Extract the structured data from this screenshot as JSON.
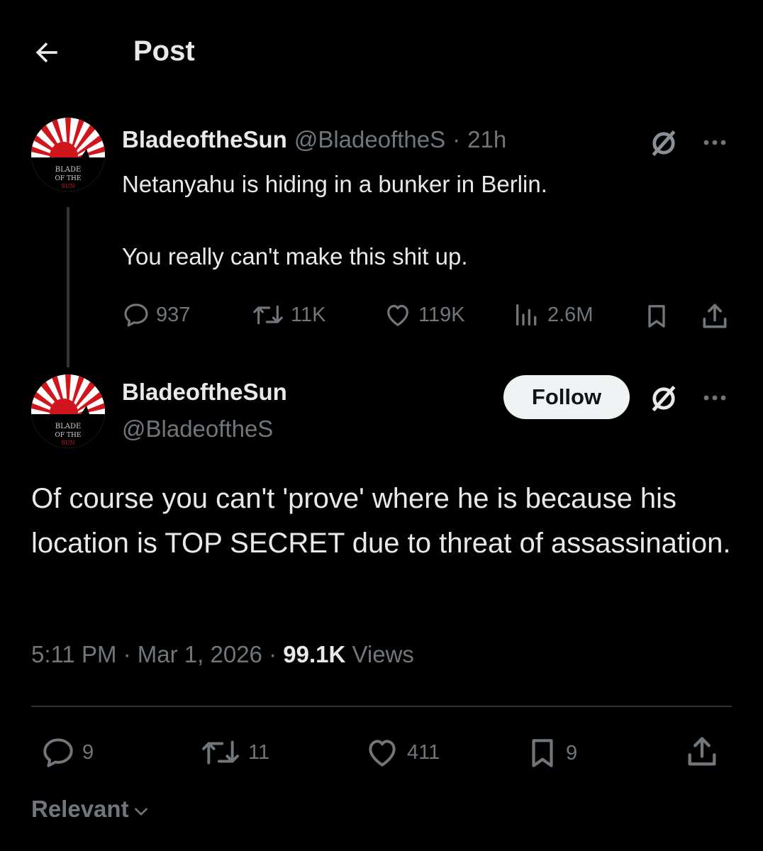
{
  "header": {
    "title": "Post",
    "back_icon": "arrow-left-icon"
  },
  "parent_post": {
    "avatar_text": [
      "BLADE",
      "OF THE",
      "SUN"
    ],
    "name": "BladeoftheSun",
    "handle": "@BladeoftheS",
    "separator": "·",
    "time": "21h",
    "line1": "Netanyahu is hiding in a bunker in Berlin.",
    "line2": "You really can't make this shit up.",
    "stats": {
      "replies": "937",
      "reposts": "11K",
      "likes": "119K",
      "views": "2.6M"
    }
  },
  "main_post": {
    "avatar_text": [
      "BLADE",
      "OF THE",
      "SUN"
    ],
    "name": "BladeoftheSun",
    "handle": "@BladeoftheS",
    "follow_label": "Follow",
    "text": "Of course you can't 'prove' where he is because his location is TOP SECRET due to threat of assassination.",
    "time": "5:11 PM",
    "date": "Mar 1, 2026",
    "separator": "·",
    "views_count": "99.1K",
    "views_label": "Views",
    "stats": {
      "replies": "9",
      "reposts": "11",
      "likes": "411",
      "bookmarks": "9"
    }
  },
  "sort": {
    "label": "Relevant"
  },
  "colors": {
    "background": "#000000",
    "text": "#e7e9ea",
    "muted": "#71767b",
    "avatar_red": "#d0151c"
  }
}
